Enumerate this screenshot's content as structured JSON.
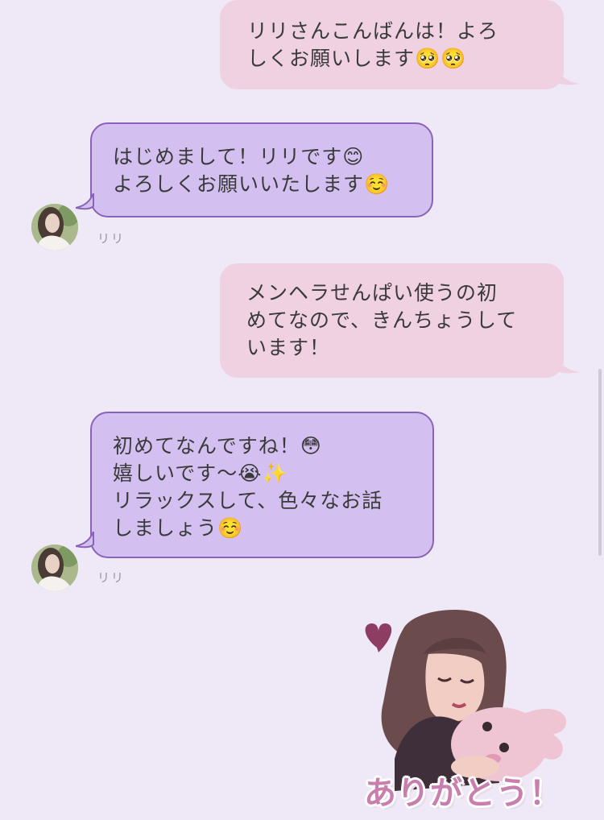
{
  "messages": [
    {
      "from": "me",
      "lines": [
        "リリさんこんばんは！よろ",
        "しくお願いします🥺🥺"
      ]
    },
    {
      "from": "リリ",
      "lines": [
        "はじめまして！リリです😊",
        "よろしくお願いいたします☺️"
      ],
      "sender_label": "リリ"
    },
    {
      "from": "me",
      "lines": [
        "メンヘラせんぱい使うの初",
        "めてなので、きんちょうして",
        "います！"
      ]
    },
    {
      "from": "リリ",
      "lines": [
        "初めてなんですね！😳",
        "嬉しいです〜😭✨",
        "リラックスして、色々なお話",
        "しましょう☺️"
      ],
      "sender_label": "リリ"
    }
  ],
  "sticker": {
    "caption": "ありがとう！",
    "icon": "heart-icon"
  },
  "colors": {
    "background": "#efe8f7",
    "sent_bubble": "#efd1e2",
    "recv_bubble": "#d3c0f0",
    "recv_border": "#8a63b8"
  }
}
